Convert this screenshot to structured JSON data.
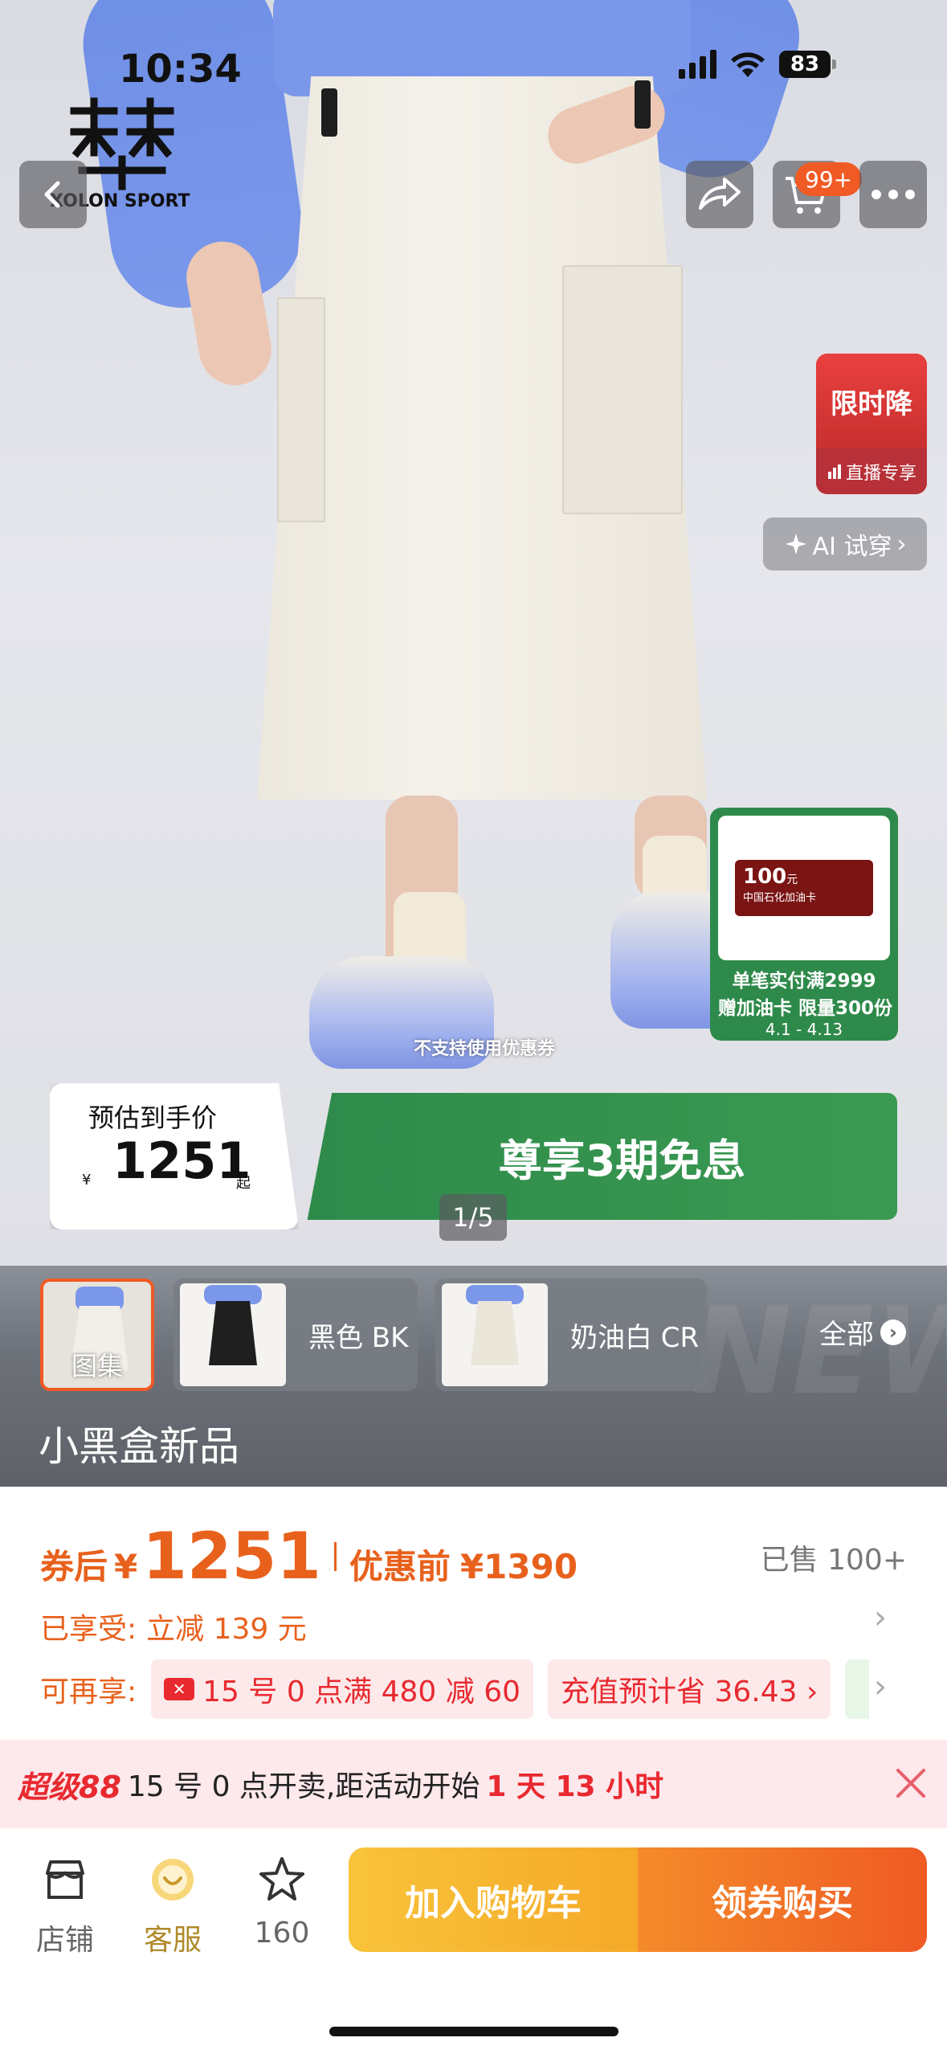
{
  "status_bar": {
    "time": "10:34",
    "battery": "83"
  },
  "brand": {
    "logo_text": "XOLON SPORT"
  },
  "nav": {
    "cart_badge": "99+"
  },
  "badges": {
    "flash_sale_title": "限时降",
    "flash_sale_sub": "直播专享",
    "ai_try_on": "AI 试穿"
  },
  "promo": {
    "card_amount": "100",
    "card_amount_unit": "元",
    "card_brand": "中国石化加油卡",
    "line1": "单笔实付满2999",
    "line2": "赠加油卡 限量300份",
    "line3": "4.1 - 4.13"
  },
  "hero": {
    "no_coupon_note": "不支持使用优惠券",
    "estimate_label": "预估到手价",
    "currency": "¥",
    "estimate_price": "1251",
    "estimate_suffix": "起",
    "installment_text": "尊享3期免息",
    "pager": "1/5"
  },
  "gallery": {
    "items": [
      {
        "label": "图集",
        "selected": true
      },
      {
        "label": "黑色 BK"
      },
      {
        "label": "奶油白 CR"
      }
    ],
    "all_label": "全部",
    "watermark": "NEW",
    "title": "小黑盒新品"
  },
  "price": {
    "after_coupon_label": "券后",
    "currency": "¥",
    "after_coupon_price": "1251",
    "before_label": "优惠前",
    "before_price": "¥1390",
    "sold": "已售 100+",
    "enjoyed_label": "已享受:",
    "enjoyed_value": "立减 139 元",
    "more_label": "可再享:",
    "chips": [
      {
        "text": "15 号 0 点满 480 减 60"
      },
      {
        "text": "充值预计省 36.43 ›"
      }
    ]
  },
  "event": {
    "logo": "超级88",
    "text": "15 号 0 点开卖,距活动开始",
    "countdown": "1 天 13 小时"
  },
  "bottom": {
    "shop": "店铺",
    "service": "客服",
    "favorites": "160",
    "add_to_cart": "加入购物车",
    "buy_with_coupon": "领券购买"
  },
  "colors": {
    "accent_orange": "#e8611c",
    "promo_green": "#2e8a4a",
    "sale_red": "#e8292f",
    "cart_yellow": "#f8c33a"
  }
}
